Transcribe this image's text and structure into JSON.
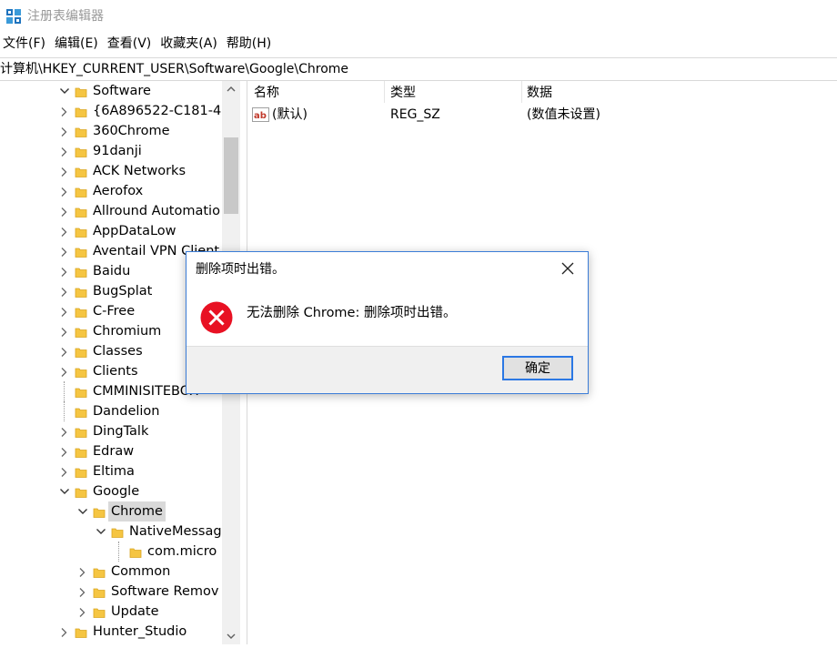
{
  "window": {
    "title": "注册表编辑器"
  },
  "menu": [
    "文件(F)",
    "编辑(E)",
    "查看(V)",
    "收藏夹(A)",
    "帮助(H)"
  ],
  "address": "计算机\\HKEY_CURRENT_USER\\Software\\Google\\Chrome",
  "tree": [
    {
      "label": "Software",
      "expanded": true
    },
    {
      "label": "{6A896522-C181-4",
      "expanded": false
    },
    {
      "label": "360Chrome",
      "expanded": false
    },
    {
      "label": "91danji",
      "expanded": false
    },
    {
      "label": "ACK Networks",
      "expanded": false
    },
    {
      "label": "Aerofox",
      "expanded": false
    },
    {
      "label": "Allround Automatio",
      "expanded": false
    },
    {
      "label": "AppDataLow",
      "expanded": false
    },
    {
      "label": "Aventail VPN Client",
      "expanded": false
    },
    {
      "label": "Baidu",
      "expanded": false
    },
    {
      "label": "BugSplat",
      "expanded": false
    },
    {
      "label": "C-Free",
      "expanded": false
    },
    {
      "label": "Chromium",
      "expanded": false
    },
    {
      "label": "Classes",
      "expanded": false
    },
    {
      "label": "Clients",
      "expanded": false
    },
    {
      "label": "CMMINISITEBOX",
      "expanded": null
    },
    {
      "label": "Dandelion",
      "expanded": null
    },
    {
      "label": "DingTalk",
      "expanded": false
    },
    {
      "label": "Edraw",
      "expanded": false
    },
    {
      "label": "Eltima",
      "expanded": false
    },
    {
      "label": "Google",
      "expanded": true
    },
    {
      "label": "Chrome",
      "expanded": true,
      "selected": true
    },
    {
      "label": "NativeMessag",
      "expanded": true
    },
    {
      "label": "com.micro",
      "expanded": null
    },
    {
      "label": "Common",
      "expanded": false
    },
    {
      "label": "Software Remov",
      "expanded": false
    },
    {
      "label": "Update",
      "expanded": false
    },
    {
      "label": "Hunter_Studio",
      "expanded": false
    }
  ],
  "columns": {
    "name": "名称",
    "type": "类型",
    "data": "数据"
  },
  "values": [
    {
      "name": "(默认)",
      "type": "REG_SZ",
      "data": "(数值未设置)"
    }
  ],
  "dialog": {
    "title": "删除项时出错。",
    "message": "无法删除 Chrome: 删除项时出错。",
    "ok_label": "确定"
  },
  "colors": {
    "accent": "#2b78e4",
    "error": "#e81123",
    "folder": "#f5c542"
  }
}
